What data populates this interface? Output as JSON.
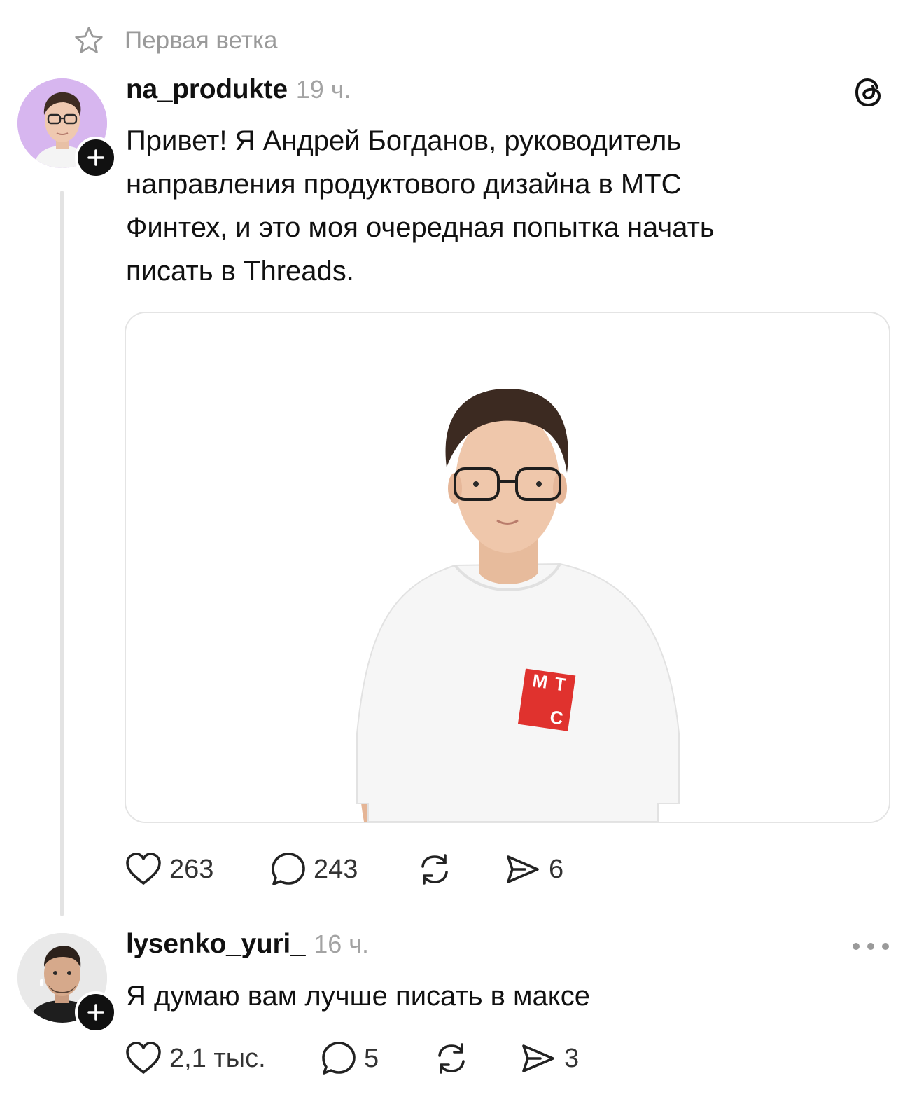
{
  "thread": {
    "title": "Первая ветка"
  },
  "post": {
    "username": "na_produkte",
    "time": "19 ч.",
    "text_lines": [
      "Привет! Я Андрей Богданов, руководитель",
      "направления продуктового дизайна в МТС",
      "Финтех, и это моя очередная попытка начать",
      "писать в Threads."
    ],
    "image": {
      "shirt_logo_letters": [
        "М",
        "Т",
        "С"
      ],
      "logo_color": "#e0322e"
    },
    "actions": {
      "likes": "263",
      "replies": "243",
      "reposts": "",
      "shares": "6"
    }
  },
  "reply": {
    "username": "lysenko_yuri_",
    "time": "16 ч.",
    "text": "Я думаю вам лучше писать в максе",
    "actions": {
      "likes": "2,1 тыс.",
      "replies": "5",
      "reposts": "",
      "shares": "3"
    }
  },
  "colors": {
    "accent": "#111111",
    "muted": "#9a9a9a",
    "brand_red": "#e0322e"
  },
  "icons": [
    "star-icon",
    "threads-logo-icon",
    "plus-icon",
    "heart-icon",
    "comment-icon",
    "repost-icon",
    "share-icon",
    "more-icon"
  ]
}
